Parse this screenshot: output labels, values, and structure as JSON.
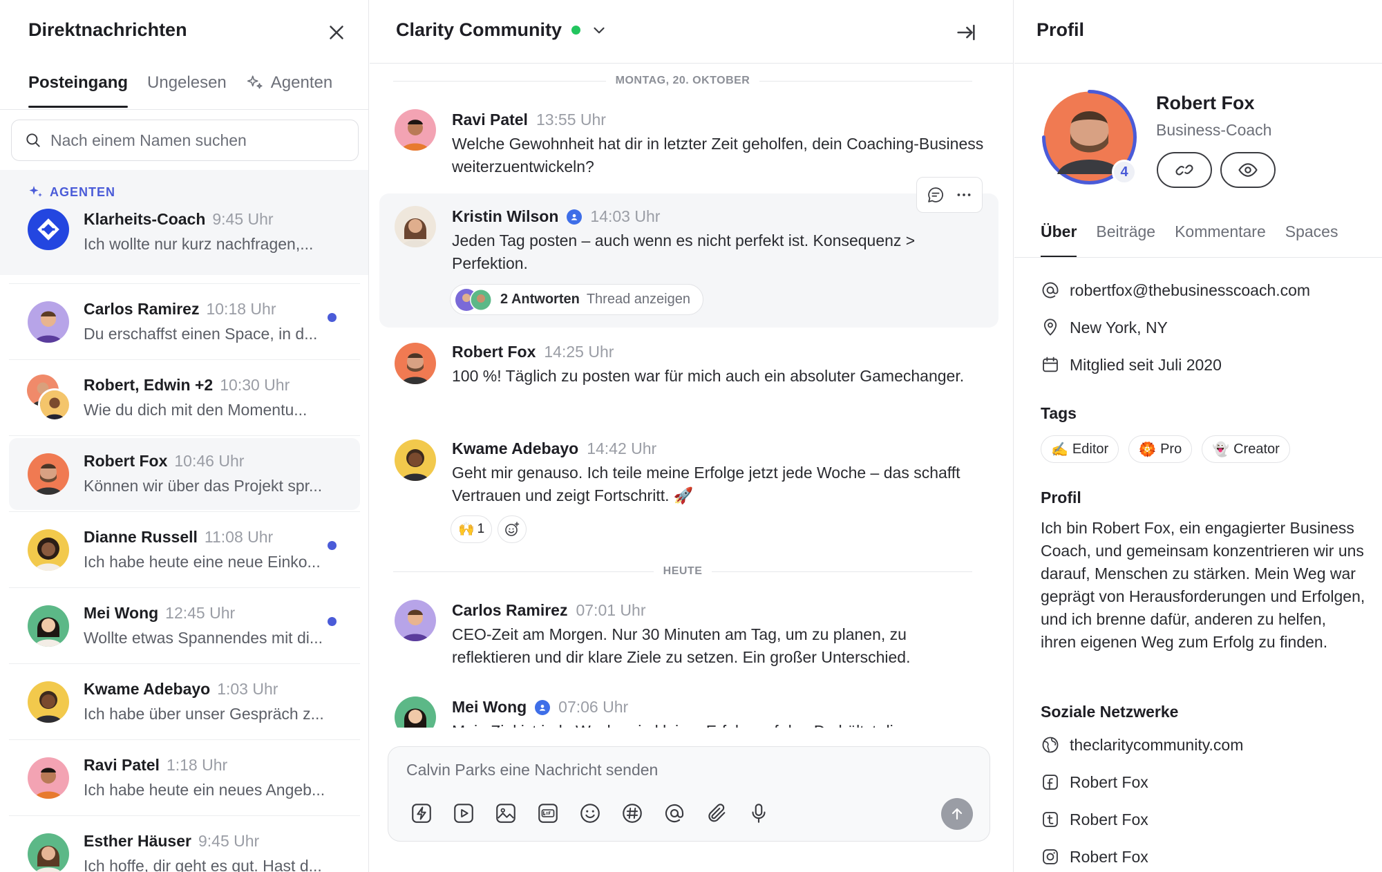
{
  "left": {
    "title": "Direktnachrichten",
    "tabs": [
      {
        "label": "Posteingang"
      },
      {
        "label": "Ungelesen"
      },
      {
        "label": "Agenten"
      }
    ],
    "search_placeholder": "Nach einem Namen suchen",
    "agents_label": "AGENTEN",
    "conversations": [
      {
        "name": "Klarheits-Coach",
        "time": "9:45 Uhr",
        "preview": "Ich wollte nur kurz nachfragen,...",
        "unread": false
      },
      {
        "name": "Carlos Ramirez",
        "time": "10:18 Uhr",
        "preview": "Du erschaffst einen Space, in d...",
        "unread": true
      },
      {
        "name": "Robert, Edwin +2",
        "time": "10:30 Uhr",
        "preview": "Wie du dich mit den Momentu...",
        "unread": false
      },
      {
        "name": "Robert Fox",
        "time": "10:46 Uhr",
        "preview": "Können wir über das Projekt spr...",
        "unread": false
      },
      {
        "name": "Dianne Russell",
        "time": "11:08 Uhr",
        "preview": "Ich habe heute eine neue Einko...",
        "unread": true
      },
      {
        "name": "Mei Wong",
        "time": "12:45 Uhr",
        "preview": "Wollte etwas Spannendes mit di...",
        "unread": true
      },
      {
        "name": "Kwame Adebayo",
        "time": "1:03 Uhr",
        "preview": "Ich habe über unser Gespräch z...",
        "unread": false
      },
      {
        "name": "Ravi Patel",
        "time": "1:18 Uhr",
        "preview": "Ich habe heute ein neues Angeb...",
        "unread": false
      },
      {
        "name": "Esther Häuser",
        "time": "9:45 Uhr",
        "preview": "Ich hoffe, dir geht es gut. Hast d...",
        "unread": false
      }
    ]
  },
  "middle": {
    "title": "Clarity Community",
    "date_sep_1": "MONTAG, 20. OKTOBER",
    "date_sep_2": "HEUTE",
    "messages": [
      {
        "author": "Ravi Patel",
        "time": "13:55 Uhr",
        "text": "Welche Gewohnheit hat dir in letzter Zeit geholfen, dein Coaching-Business weiterzuentwickeln?"
      },
      {
        "author": "Kristin Wilson",
        "time": "14:03 Uhr",
        "text": "Jeden Tag posten – auch wenn es nicht perfekt ist. Konsequenz > Perfektion.",
        "thread_count": "2 Antworten",
        "thread_link": "Thread anzeigen"
      },
      {
        "author": "Robert Fox",
        "time": "14:25 Uhr",
        "text": "100 %! Täglich zu posten war für mich auch ein absoluter Gamechanger."
      },
      {
        "author": "Kwame Adebayo",
        "time": "14:42 Uhr",
        "text": "Geht mir genauso. Ich teile meine Erfolge jetzt jede Woche – das schafft Vertrauen und zeigt Fortschritt. 🚀",
        "reaction_emoji": "🙌",
        "reaction_count": "1"
      },
      {
        "author": "Carlos Ramirez",
        "time": "07:01 Uhr",
        "text": "CEO-Zeit am Morgen. Nur 30 Minuten am Tag, um zu planen, zu reflektieren und dir klare Ziele zu setzen. Ein großer Unterschied."
      },
      {
        "author": "Mei Wong",
        "time": "07:06 Uhr",
        "text": "Mein Ziel ist jede Woche ein kleiner Erfolg, auf den Du hältst die..."
      }
    ],
    "composer_placeholder": "Calvin Parks eine Nachricht senden"
  },
  "right": {
    "title": "Profil",
    "name": "Robert Fox",
    "role": "Business-Coach",
    "badge": "4",
    "tabs": [
      {
        "label": "Über"
      },
      {
        "label": "Beiträge"
      },
      {
        "label": "Kommentare"
      },
      {
        "label": "Spaces"
      }
    ],
    "email": "robertfox@thebusinesscoach.com",
    "location": "New York, NY",
    "member_since": "Mitglied seit Juli 2020",
    "tags_heading": "Tags",
    "tags": [
      {
        "emoji": "✍️",
        "label": "Editor"
      },
      {
        "emoji": "🏵️",
        "label": "Pro"
      },
      {
        "emoji": "👻",
        "label": "Creator"
      }
    ],
    "profile_heading": "Profil",
    "bio": "Ich bin Robert Fox, ein engagierter Business Coach, und gemeinsam konzentrieren wir uns darauf, Menschen zu stärken. Mein Weg war geprägt von Herausforderungen und Erfolgen, und ich brenne dafür, anderen zu helfen, ihren eigenen Weg zum Erfolg zu finden.",
    "social_heading": "Soziale Netzwerke",
    "social": [
      {
        "label": "theclaritycommunity.com"
      },
      {
        "label": "Robert Fox"
      },
      {
        "label": "Robert Fox"
      },
      {
        "label": "Robert Fox"
      }
    ]
  }
}
